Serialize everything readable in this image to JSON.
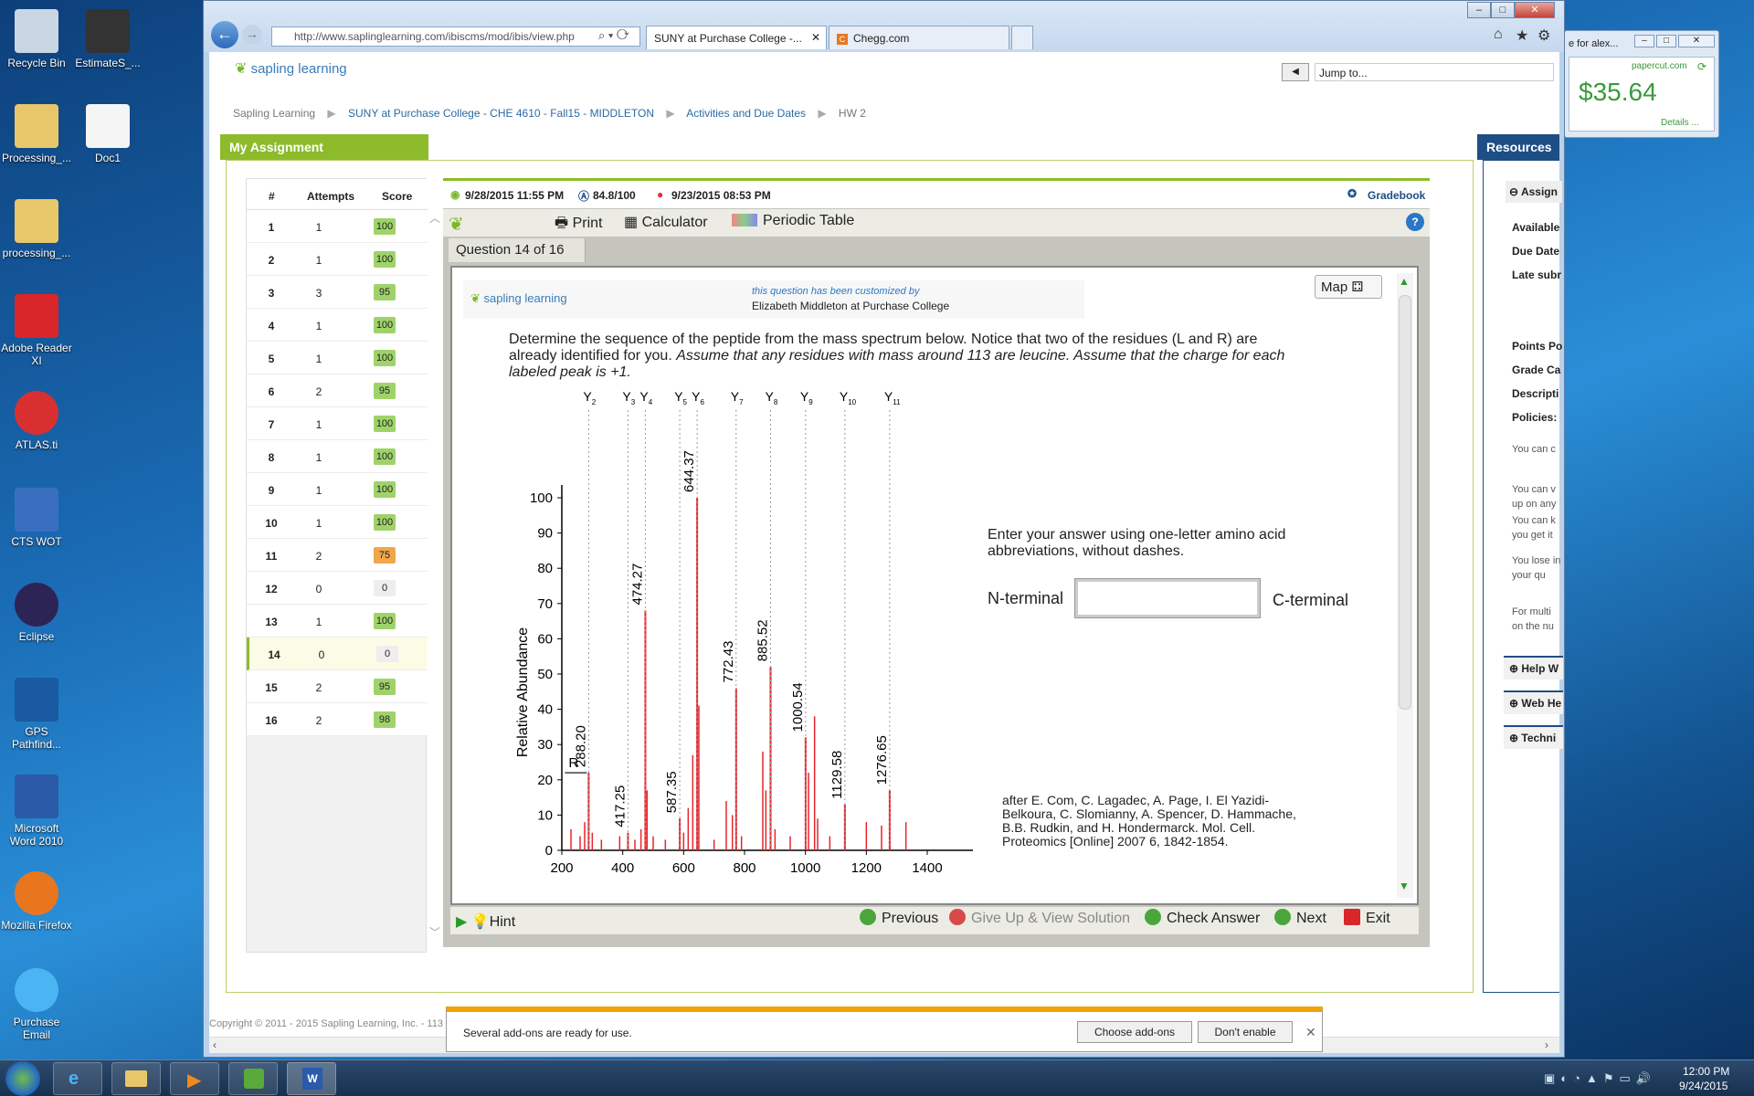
{
  "desktop": {
    "icons": [
      {
        "label": "Recycle Bin",
        "icon": "recycle-bin-icon"
      },
      {
        "label": "EstimateS_...",
        "icon": "program-icon"
      },
      {
        "label": "Processing_...",
        "icon": "folder-icon"
      },
      {
        "label": "Doc1",
        "icon": "word-doc-icon"
      },
      {
        "label": "processing_...",
        "icon": "folder-icon"
      },
      {
        "label": "Adobe Reader XI",
        "icon": "adobe-reader-icon"
      },
      {
        "label": "ATLAS.ti",
        "icon": "atlas-icon"
      },
      {
        "label": "CTS WOT",
        "icon": "cts-icon"
      },
      {
        "label": "Eclipse",
        "icon": "eclipse-icon"
      },
      {
        "label": "GPS Pathfind...",
        "icon": "gps-icon"
      },
      {
        "label": "Microsoft Word 2010",
        "icon": "word-icon"
      },
      {
        "label": "Mozilla Firefox",
        "icon": "firefox-icon"
      },
      {
        "label": "Purchase Email",
        "icon": "ie-icon"
      }
    ]
  },
  "taskbar": {
    "time": "12:00 PM",
    "date": "9/24/2015"
  },
  "papercut": {
    "title": "e for alex...",
    "brand": "papercut.com",
    "balance": "$35.64",
    "details": "Details ..."
  },
  "browser": {
    "url": "http://www.saplinglearning.com/ibiscms/mod/ibis/view.php",
    "tabs": [
      "SUNY at Purchase College -...",
      "Chegg.com"
    ],
    "notification": {
      "text": "Several add-ons are ready for use.",
      "choose": "Choose add-ons",
      "dont": "Don't enable"
    }
  },
  "site": {
    "logo": "sapling learning",
    "jump": "Jump to...",
    "breadcrumb": [
      "Sapling Learning",
      "SUNY at Purchase College - CHE 4610 - Fall15 - MIDDLETON",
      "Activities and Due Dates",
      "HW 2"
    ],
    "my_assignment": "My Assignment",
    "resources": "Resources",
    "copyright": "Copyright © 2011 - 2015 Sapling Learning, Inc. - 113"
  },
  "table": {
    "headers": [
      "#",
      "Attempts",
      "Score"
    ],
    "rows": [
      {
        "n": "1",
        "a": "1",
        "s": "100",
        "c": "#9fd36a"
      },
      {
        "n": "2",
        "a": "1",
        "s": "100",
        "c": "#9fd36a"
      },
      {
        "n": "3",
        "a": "3",
        "s": "95",
        "c": "#9fd36a"
      },
      {
        "n": "4",
        "a": "1",
        "s": "100",
        "c": "#9fd36a"
      },
      {
        "n": "5",
        "a": "1",
        "s": "100",
        "c": "#9fd36a"
      },
      {
        "n": "6",
        "a": "2",
        "s": "95",
        "c": "#9fd36a"
      },
      {
        "n": "7",
        "a": "1",
        "s": "100",
        "c": "#9fd36a"
      },
      {
        "n": "8",
        "a": "1",
        "s": "100",
        "c": "#9fd36a"
      },
      {
        "n": "9",
        "a": "1",
        "s": "100",
        "c": "#9fd36a"
      },
      {
        "n": "10",
        "a": "1",
        "s": "100",
        "c": "#9fd36a"
      },
      {
        "n": "11",
        "a": "2",
        "s": "75",
        "c": "#f0a64a"
      },
      {
        "n": "12",
        "a": "0",
        "s": "0",
        "c": "#eeeeee"
      },
      {
        "n": "13",
        "a": "1",
        "s": "100",
        "c": "#9fd36a"
      },
      {
        "n": "14",
        "a": "0",
        "s": "0",
        "c": "#eeeeee"
      },
      {
        "n": "15",
        "a": "2",
        "s": "95",
        "c": "#9fd36a"
      },
      {
        "n": "16",
        "a": "2",
        "s": "98",
        "c": "#9fd36a"
      }
    ]
  },
  "status": {
    "due": "9/28/2015 11:55 PM",
    "grade": "84.8/100",
    "late": "9/23/2015 08:53 PM",
    "gradebook": "Gradebook"
  },
  "toolbar": {
    "print": "Print",
    "calculator": "Calculator",
    "periodic": "Periodic Table"
  },
  "question": {
    "tab": "Question 14 of 16",
    "map": "Map",
    "customized": "this question has been customized by",
    "author": "Elizabeth Middleton at Purchase College",
    "text1": "Determine the sequence of the peptide from the mass spectrum below. Notice that two of the residues (L and R) are already identified for you. ",
    "text2": "Assume that any residues with mass around 113 are leucine. Assume that the charge for each labeled peak is +1.",
    "answer_prompt": "Enter your answer using one-letter amino acid abbreviations, without dashes.",
    "n_term": "N-terminal",
    "c_term": "C-terminal",
    "answer": "",
    "citation": "after E. Com, C. Lagadec, A. Page, I. El Yazidi-Belkoura, C. Slomianny, A. Spencer, D. Hammache, B.B. Rudkin, and H. Hondermarck. Mol. Cell. Proteomics [Online] 2007 6, 1842-1854."
  },
  "buttons": {
    "hint": "Hint",
    "previous": "Previous",
    "giveup": "Give Up & View Solution",
    "check": "Check Answer",
    "next": "Next",
    "exit": "Exit"
  },
  "resources_panel": {
    "assign": "Assign",
    "labels": [
      "Available",
      "Due Date",
      "Late subr",
      "Points Po",
      "Grade Ca",
      "Descripti",
      "Policies:"
    ],
    "texts": [
      "You can c",
      "You can v up on any",
      "You can k you get it",
      "You lose in your qu answer.",
      "For multi on the nu"
    ],
    "sections": [
      "Help W",
      "Web He",
      "Techni"
    ]
  },
  "chart_data": {
    "type": "bar",
    "ylabel": "Relative Abundance",
    "xlim": [
      200,
      1400
    ],
    "ylim": [
      0,
      100
    ],
    "xticks": [
      200,
      400,
      600,
      800,
      1000,
      1200,
      1400
    ],
    "yticks": [
      0,
      10,
      20,
      30,
      40,
      50,
      60,
      70,
      80,
      90,
      100
    ],
    "labeled_peaks": [
      {
        "x": 288.2,
        "y": 22,
        "label": "288.20"
      },
      {
        "x": 417.25,
        "y": 5,
        "label": "417.25"
      },
      {
        "x": 474.27,
        "y": 68,
        "label": "474.27"
      },
      {
        "x": 587.35,
        "y": 9,
        "label": "587.35"
      },
      {
        "x": 644.37,
        "y": 100,
        "label": "644.37"
      },
      {
        "x": 772.43,
        "y": 46,
        "label": "772.43"
      },
      {
        "x": 885.52,
        "y": 52,
        "label": "885.52"
      },
      {
        "x": 1000.54,
        "y": 32,
        "label": "1000.54"
      },
      {
        "x": 1129.58,
        "y": 13,
        "label": "1129.58"
      },
      {
        "x": 1276.65,
        "y": 17,
        "label": "1276.65"
      }
    ],
    "minor_peaks": [
      {
        "x": 230,
        "y": 6
      },
      {
        "x": 260,
        "y": 4
      },
      {
        "x": 275,
        "y": 8
      },
      {
        "x": 300,
        "y": 5
      },
      {
        "x": 330,
        "y": 3
      },
      {
        "x": 390,
        "y": 4
      },
      {
        "x": 440,
        "y": 3
      },
      {
        "x": 460,
        "y": 6
      },
      {
        "x": 480,
        "y": 17
      },
      {
        "x": 500,
        "y": 4
      },
      {
        "x": 540,
        "y": 3
      },
      {
        "x": 600,
        "y": 5
      },
      {
        "x": 615,
        "y": 12
      },
      {
        "x": 630,
        "y": 27
      },
      {
        "x": 650,
        "y": 41
      },
      {
        "x": 700,
        "y": 3
      },
      {
        "x": 740,
        "y": 14
      },
      {
        "x": 760,
        "y": 10
      },
      {
        "x": 790,
        "y": 4
      },
      {
        "x": 860,
        "y": 28
      },
      {
        "x": 870,
        "y": 17
      },
      {
        "x": 900,
        "y": 6
      },
      {
        "x": 950,
        "y": 4
      },
      {
        "x": 1010,
        "y": 22
      },
      {
        "x": 1030,
        "y": 38
      },
      {
        "x": 1040,
        "y": 9
      },
      {
        "x": 1080,
        "y": 4
      },
      {
        "x": 1200,
        "y": 8
      },
      {
        "x": 1250,
        "y": 7
      },
      {
        "x": 1330,
        "y": 8
      }
    ],
    "ion_labels": [
      {
        "name": "Y",
        "sub": "2",
        "x": 288.2
      },
      {
        "name": "Y",
        "sub": "3",
        "x": 417.25
      },
      {
        "name": "Y",
        "sub": "4",
        "x": 474.27
      },
      {
        "name": "Y",
        "sub": "5",
        "x": 587.35
      },
      {
        "name": "Y",
        "sub": "6",
        "x": 644.37
      },
      {
        "name": "Y",
        "sub": "7",
        "x": 772.43
      },
      {
        "name": "Y",
        "sub": "8",
        "x": 885.52
      },
      {
        "name": "Y",
        "sub": "9",
        "x": 1000.54
      },
      {
        "name": "Y",
        "sub": "10",
        "x": 1129.58
      },
      {
        "name": "Y",
        "sub": "11",
        "x": 1276.65
      }
    ],
    "annotation": "R",
    "bar_color": "#e8242b"
  }
}
